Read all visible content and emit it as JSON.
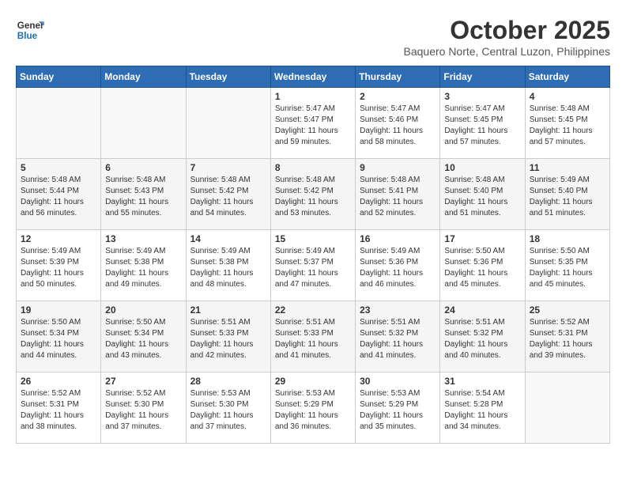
{
  "logo": {
    "line1": "General",
    "line2": "Blue"
  },
  "title": "October 2025",
  "subtitle": "Baquero Norte, Central Luzon, Philippines",
  "headers": [
    "Sunday",
    "Monday",
    "Tuesday",
    "Wednesday",
    "Thursday",
    "Friday",
    "Saturday"
  ],
  "weeks": [
    [
      {
        "day": "",
        "info": ""
      },
      {
        "day": "",
        "info": ""
      },
      {
        "day": "",
        "info": ""
      },
      {
        "day": "1",
        "info": "Sunrise: 5:47 AM\nSunset: 5:47 PM\nDaylight: 11 hours\nand 59 minutes."
      },
      {
        "day": "2",
        "info": "Sunrise: 5:47 AM\nSunset: 5:46 PM\nDaylight: 11 hours\nand 58 minutes."
      },
      {
        "day": "3",
        "info": "Sunrise: 5:47 AM\nSunset: 5:45 PM\nDaylight: 11 hours\nand 57 minutes."
      },
      {
        "day": "4",
        "info": "Sunrise: 5:48 AM\nSunset: 5:45 PM\nDaylight: 11 hours\nand 57 minutes."
      }
    ],
    [
      {
        "day": "5",
        "info": "Sunrise: 5:48 AM\nSunset: 5:44 PM\nDaylight: 11 hours\nand 56 minutes."
      },
      {
        "day": "6",
        "info": "Sunrise: 5:48 AM\nSunset: 5:43 PM\nDaylight: 11 hours\nand 55 minutes."
      },
      {
        "day": "7",
        "info": "Sunrise: 5:48 AM\nSunset: 5:42 PM\nDaylight: 11 hours\nand 54 minutes."
      },
      {
        "day": "8",
        "info": "Sunrise: 5:48 AM\nSunset: 5:42 PM\nDaylight: 11 hours\nand 53 minutes."
      },
      {
        "day": "9",
        "info": "Sunrise: 5:48 AM\nSunset: 5:41 PM\nDaylight: 11 hours\nand 52 minutes."
      },
      {
        "day": "10",
        "info": "Sunrise: 5:48 AM\nSunset: 5:40 PM\nDaylight: 11 hours\nand 51 minutes."
      },
      {
        "day": "11",
        "info": "Sunrise: 5:49 AM\nSunset: 5:40 PM\nDaylight: 11 hours\nand 51 minutes."
      }
    ],
    [
      {
        "day": "12",
        "info": "Sunrise: 5:49 AM\nSunset: 5:39 PM\nDaylight: 11 hours\nand 50 minutes."
      },
      {
        "day": "13",
        "info": "Sunrise: 5:49 AM\nSunset: 5:38 PM\nDaylight: 11 hours\nand 49 minutes."
      },
      {
        "day": "14",
        "info": "Sunrise: 5:49 AM\nSunset: 5:38 PM\nDaylight: 11 hours\nand 48 minutes."
      },
      {
        "day": "15",
        "info": "Sunrise: 5:49 AM\nSunset: 5:37 PM\nDaylight: 11 hours\nand 47 minutes."
      },
      {
        "day": "16",
        "info": "Sunrise: 5:49 AM\nSunset: 5:36 PM\nDaylight: 11 hours\nand 46 minutes."
      },
      {
        "day": "17",
        "info": "Sunrise: 5:50 AM\nSunset: 5:36 PM\nDaylight: 11 hours\nand 45 minutes."
      },
      {
        "day": "18",
        "info": "Sunrise: 5:50 AM\nSunset: 5:35 PM\nDaylight: 11 hours\nand 45 minutes."
      }
    ],
    [
      {
        "day": "19",
        "info": "Sunrise: 5:50 AM\nSunset: 5:34 PM\nDaylight: 11 hours\nand 44 minutes."
      },
      {
        "day": "20",
        "info": "Sunrise: 5:50 AM\nSunset: 5:34 PM\nDaylight: 11 hours\nand 43 minutes."
      },
      {
        "day": "21",
        "info": "Sunrise: 5:51 AM\nSunset: 5:33 PM\nDaylight: 11 hours\nand 42 minutes."
      },
      {
        "day": "22",
        "info": "Sunrise: 5:51 AM\nSunset: 5:33 PM\nDaylight: 11 hours\nand 41 minutes."
      },
      {
        "day": "23",
        "info": "Sunrise: 5:51 AM\nSunset: 5:32 PM\nDaylight: 11 hours\nand 41 minutes."
      },
      {
        "day": "24",
        "info": "Sunrise: 5:51 AM\nSunset: 5:32 PM\nDaylight: 11 hours\nand 40 minutes."
      },
      {
        "day": "25",
        "info": "Sunrise: 5:52 AM\nSunset: 5:31 PM\nDaylight: 11 hours\nand 39 minutes."
      }
    ],
    [
      {
        "day": "26",
        "info": "Sunrise: 5:52 AM\nSunset: 5:31 PM\nDaylight: 11 hours\nand 38 minutes."
      },
      {
        "day": "27",
        "info": "Sunrise: 5:52 AM\nSunset: 5:30 PM\nDaylight: 11 hours\nand 37 minutes."
      },
      {
        "day": "28",
        "info": "Sunrise: 5:53 AM\nSunset: 5:30 PM\nDaylight: 11 hours\nand 37 minutes."
      },
      {
        "day": "29",
        "info": "Sunrise: 5:53 AM\nSunset: 5:29 PM\nDaylight: 11 hours\nand 36 minutes."
      },
      {
        "day": "30",
        "info": "Sunrise: 5:53 AM\nSunset: 5:29 PM\nDaylight: 11 hours\nand 35 minutes."
      },
      {
        "day": "31",
        "info": "Sunrise: 5:54 AM\nSunset: 5:28 PM\nDaylight: 11 hours\nand 34 minutes."
      },
      {
        "day": "",
        "info": ""
      }
    ]
  ]
}
